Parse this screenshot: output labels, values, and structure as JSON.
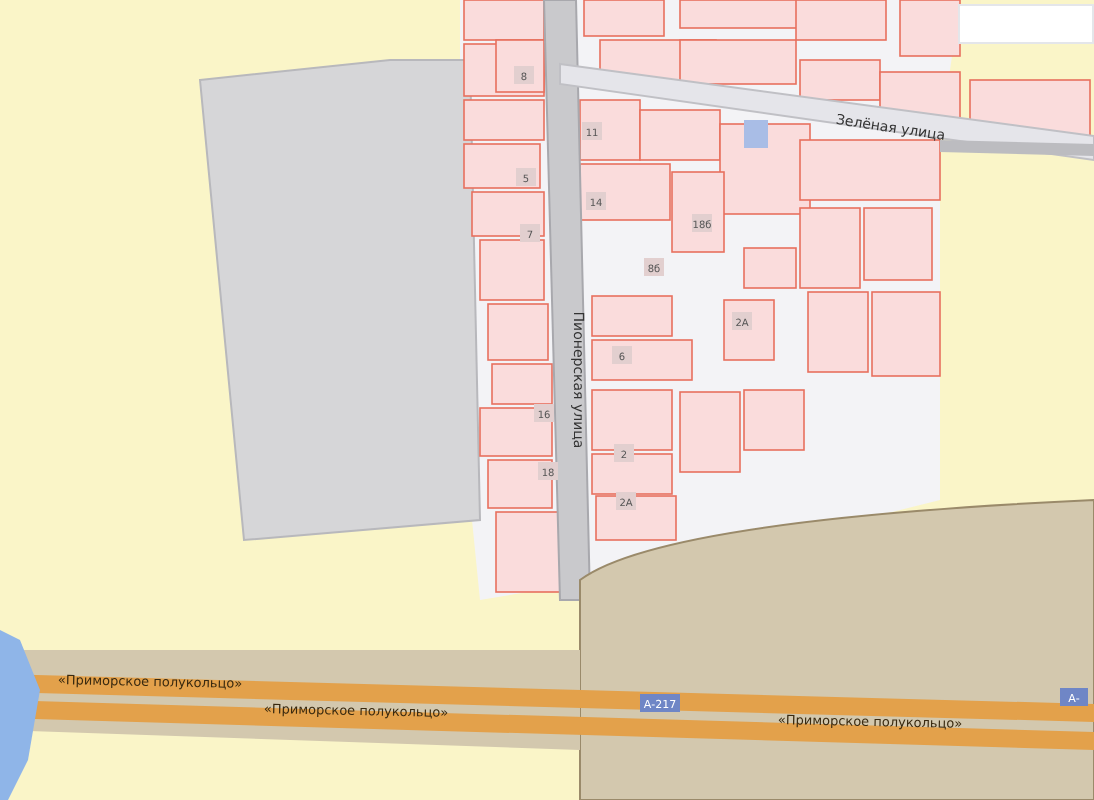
{
  "map": {
    "streets": [
      {
        "name": "Зелёная улица"
      },
      {
        "name": "Пионерская улица"
      }
    ],
    "roads": [
      {
        "name": "«Приморское полукольцо»"
      },
      {
        "name": "«Приморское полукольцо»"
      },
      {
        "name": "«Приморское полукольцо»"
      }
    ],
    "route_shields": [
      {
        "label": "А-217"
      },
      {
        "label": "А-"
      }
    ],
    "house_numbers": [
      "8",
      "11",
      "5",
      "7",
      "14",
      "18б",
      "8б",
      "2А",
      "6",
      "16",
      "18",
      "2",
      "2А"
    ]
  }
}
